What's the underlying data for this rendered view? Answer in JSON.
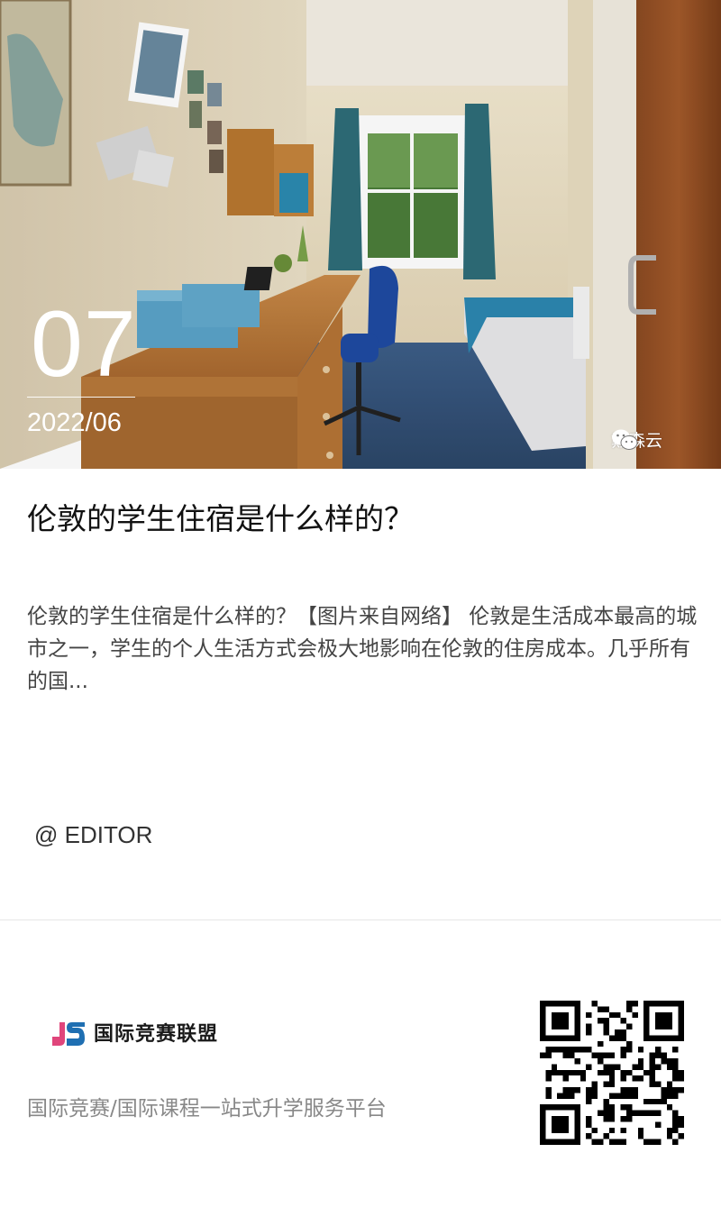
{
  "hero": {
    "date_day": "07",
    "date_year_month": "2022/06",
    "watermark_text": "戴森云",
    "watermark_icon": "wechat-icon"
  },
  "article": {
    "title": "伦敦的学生住宿是什么样的？",
    "summary": "伦敦的学生住宿是什么样的？【图片来自网络】 伦敦是生活成本最高的城市之一，学生的个人生活方式会极大地影响在伦敦的住房成本。几乎所有的国...",
    "editor": "@ EDITOR"
  },
  "footer": {
    "brand_name": "国际竞赛联盟",
    "logo_icon": "js-logo-icon",
    "tagline": "国际竞赛/国际课程一站式升学服务平台",
    "qr_icon": "qr-code-icon"
  },
  "colors": {
    "title": "#111111",
    "summary": "#444444",
    "tagline": "#888888",
    "logo_blue": "#1f6fb2",
    "logo_pink": "#e0457b"
  }
}
